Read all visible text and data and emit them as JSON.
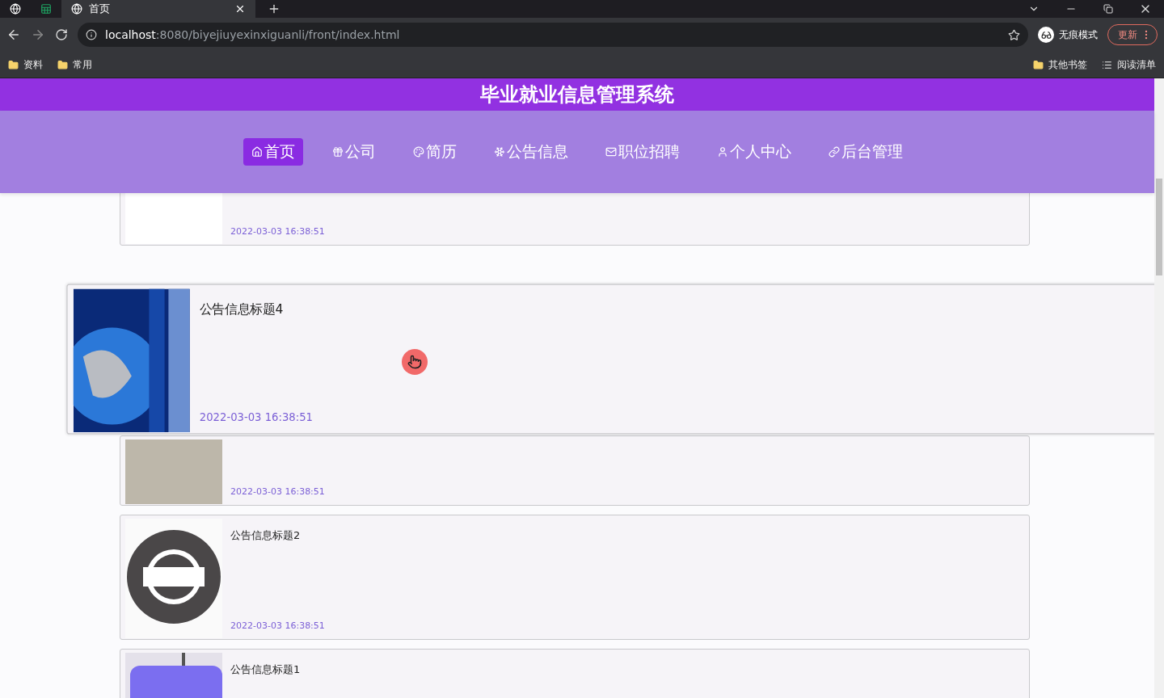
{
  "browser": {
    "tabs": [
      {
        "kind": "globe",
        "selected": false
      },
      {
        "kind": "sheet",
        "selected": false
      },
      {
        "kind": "page",
        "title": "首页",
        "selected": true
      }
    ],
    "address": {
      "host": "localhost",
      "path": ":8080/biyejiuyexinxiguanli/front/index.html"
    },
    "profile": "无痕模式",
    "update_button": "更新",
    "bookmarks_left": [
      "资料",
      "常用"
    ],
    "bookmarks_right": [
      "其他书签",
      "阅读清单"
    ]
  },
  "site_title": "毕业就业信息管理系统",
  "nav": [
    {
      "label": "首页",
      "selected": true
    },
    {
      "label": "公司",
      "selected": false
    },
    {
      "label": "简历",
      "selected": false
    },
    {
      "label": "公告信息",
      "selected": false
    },
    {
      "label": "职位招聘",
      "selected": false
    },
    {
      "label": "个人中心",
      "selected": false
    },
    {
      "label": "后台管理",
      "selected": false
    }
  ],
  "notices": [
    {
      "date": "2022-03-03 16:38:51",
      "hovered": false
    },
    {
      "title": "公告信息标题4",
      "date": "2022-03-03 16:38:51",
      "hovered": true
    },
    {
      "date": "2022-03-03 16:38:51",
      "hovered": false
    },
    {
      "title": "公告信息标题2",
      "date": "2022-03-03 16:38:51",
      "hovered": false
    },
    {
      "title": "公告信息标题1",
      "hovered": false
    }
  ]
}
